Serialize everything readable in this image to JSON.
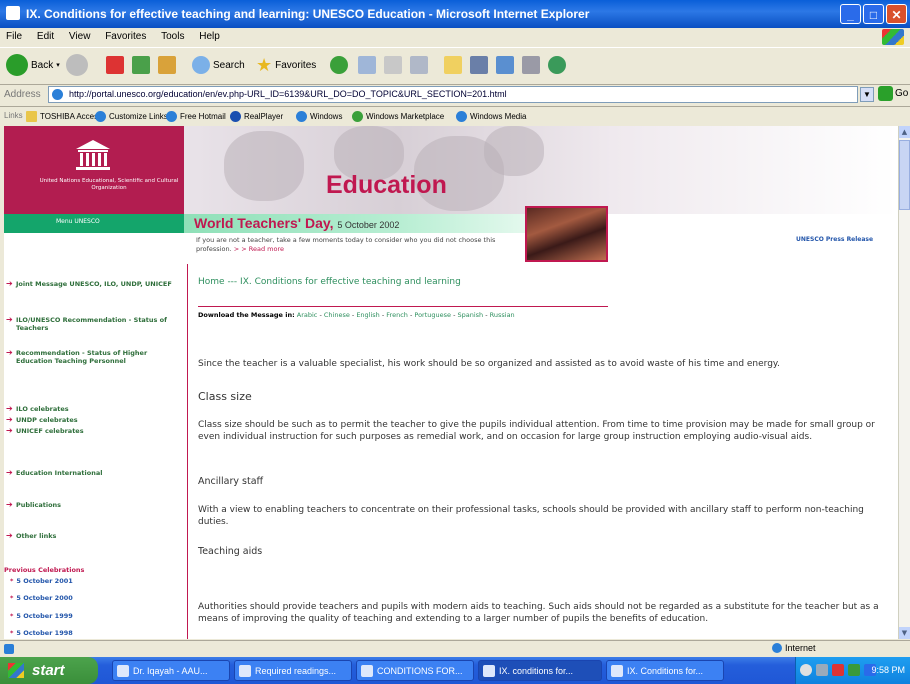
{
  "window": {
    "title": "IX. Conditions for effective teaching and learning: UNESCO Education - Microsoft Internet Explorer",
    "minimize": "_",
    "maximize": "□",
    "close": "✕"
  },
  "menu": [
    "File",
    "Edit",
    "View",
    "Favorites",
    "Tools",
    "Help"
  ],
  "toolbar": {
    "back": "Back",
    "search": "Search",
    "favorites": "Favorites"
  },
  "address": {
    "label": "Address",
    "url": "http://portal.unesco.org/education/en/ev.php-URL_ID=6139&URL_DO=DO_TOPIC&URL_SECTION=201.html",
    "go": "Go"
  },
  "links": {
    "label": "Links",
    "items": [
      "TOSHIBA Access",
      "Customize Links",
      "Free Hotmail",
      "RealPlayer",
      "Windows",
      "Windows Marketplace",
      "Windows Media"
    ]
  },
  "banner": {
    "org_name": "United Nations Educational, Scientific and Cultural Organization",
    "section_title": "Education",
    "menu_label": "Menu UNESCO",
    "event_title": "World Teachers' Day,",
    "event_date": "5 October 2002",
    "intro": "If you are not a teacher, take a few moments today to consider who you did not choose this profession.",
    "more": "> > Read more",
    "press": "UNESCO Press Release"
  },
  "sidebar": {
    "items": [
      "Joint Message UNESCO, ILO, UNDP, UNICEF",
      "ILO/UNESCO Recommendation - Status of Teachers",
      "Recommendation - Status of Higher Education Teaching Personnel",
      "ILO celebrates",
      "UNDP celebrates",
      "UNICEF celebrates",
      "Education International",
      "Publications",
      "Other links"
    ],
    "previous_heading": "Previous Celebrations",
    "previous": [
      "5 October 2001",
      "5 October 2000",
      "5 October 1999",
      "5 October 1998"
    ]
  },
  "main": {
    "breadcrumb": "Home --- IX. Conditions for effective teaching and learning",
    "download_label": "Download the Message in:",
    "languages": [
      "Arabic",
      "Chinese",
      "English",
      "French",
      "Portuguese",
      "Spanish",
      "Russian"
    ],
    "intro_para": "Since the teacher is a valuable specialist, his work should be so organized and assisted as to avoid waste of his time and energy.",
    "sections": [
      {
        "heading": "Class size",
        "text": "Class size should be such as to permit the teacher to give the pupils individual attention. From time to time provision may be made for small group or even individual instruction for such purposes as remedial work, and on occasion for large group instruction employing audio-visual aids."
      },
      {
        "heading": "Ancillary staff",
        "text": "With a view to enabling teachers to concentrate on their professional tasks, schools should be provided with ancillary staff to perform non-teaching duties."
      },
      {
        "heading": "Teaching aids",
        "text": "Authorities should provide teachers and pupils with modern aids to teaching. Such aids should not be regarded as a substitute for the teacher but as a means of improving the quality of teaching and extending to a larger number of pupils the benefits of education."
      }
    ]
  },
  "status": {
    "zone": "Internet"
  },
  "taskbar": {
    "start": "start",
    "tasks": [
      "Dr. Iqayah - AAU...",
      "Required readings...",
      "CONDITIONS FOR...",
      "IX. conditions for...",
      "IX. Conditions for..."
    ],
    "clock": "9:58 PM"
  },
  "colors": {
    "unesco_magenta": "#b21d50",
    "unesco_green": "#14a56b",
    "link_green": "#2e8f5e",
    "xp_blue": "#245edb"
  }
}
